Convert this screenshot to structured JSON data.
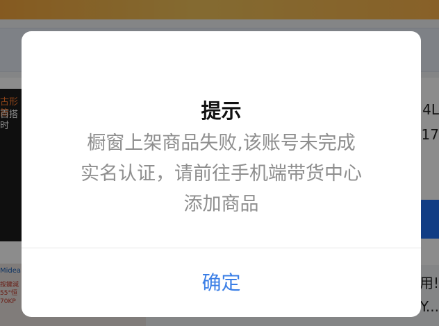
{
  "background": {
    "thumb1_line1": "古形简",
    "thumb1_line2": "百搭时",
    "thumb2_brand": "Midea",
    "thumb2_lines": [
      "按鍵減",
      "55°恒",
      "70KP"
    ],
    "right_text_1": "4L",
    "right_text_2": "17",
    "right_text_3": "用!",
    "right_text_4": "Y..."
  },
  "dialog": {
    "title": "提示",
    "message_lines": [
      "橱窗上架商品失败,该账号未完成",
      "实名认证，请前往手机端带货中心",
      "添加商品"
    ],
    "confirm_label": "确定"
  },
  "colors": {
    "title": "#111111",
    "message": "#8e8e8e",
    "confirm": "#3a7ee6",
    "overlay": "rgba(0,0,0,0.45)"
  }
}
